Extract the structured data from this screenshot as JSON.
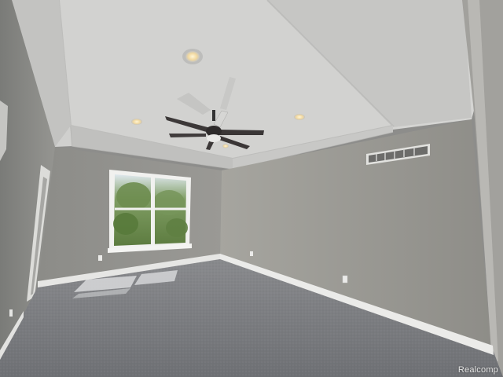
{
  "scene": {
    "watermark": "Realcomp",
    "colors": {
      "wall_light": "#9c9b97",
      "wall_dark": "#6f706c",
      "ceiling": "#cfcfcd",
      "trim": "#eeeeec",
      "carpet": "#7d7f82",
      "window_foliage": "#6b8a4e",
      "fan_blade": "#3c3838"
    },
    "icons": [
      "ceiling-fan-icon",
      "recessed-light-icon",
      "air-vent-icon",
      "outlet-icon"
    ]
  }
}
